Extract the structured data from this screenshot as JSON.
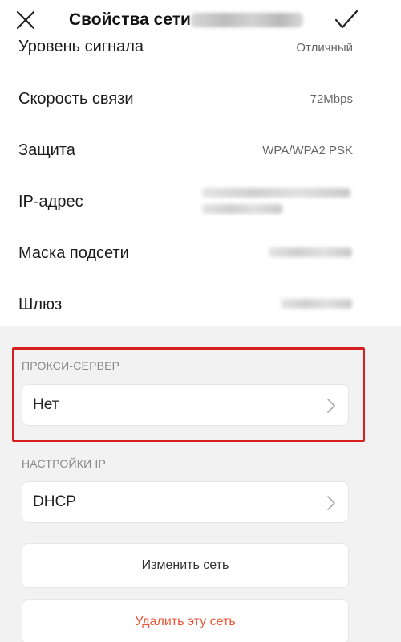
{
  "header": {
    "title": "Свойства сети",
    "close_icon": "close-icon",
    "confirm_icon": "checkmark-icon"
  },
  "info_rows": [
    {
      "key": "signal",
      "label": "Уровень сигнала",
      "value": "Отличный"
    },
    {
      "key": "speed",
      "label": "Скорость связи",
      "value": "72Mbps"
    },
    {
      "key": "security",
      "label": "Защита",
      "value": "WPA/WPA2 PSK"
    },
    {
      "key": "ip",
      "label": "IP-адрес",
      "value": ""
    },
    {
      "key": "mask",
      "label": "Маска подсети",
      "value": ""
    },
    {
      "key": "gateway",
      "label": "Шлюз",
      "value": ""
    }
  ],
  "proxy": {
    "section_label": "ПРОКСИ-СЕРВЕР",
    "value": "Нет"
  },
  "ip_settings": {
    "section_label": "НАСТРОЙКИ IP",
    "value": "DHCP"
  },
  "actions": {
    "modify_label": "Изменить сеть",
    "delete_label": "Удалить эту сеть"
  },
  "colors": {
    "highlight": "#d62020",
    "danger_text": "#e8563a",
    "background": "#f2f2f2"
  }
}
